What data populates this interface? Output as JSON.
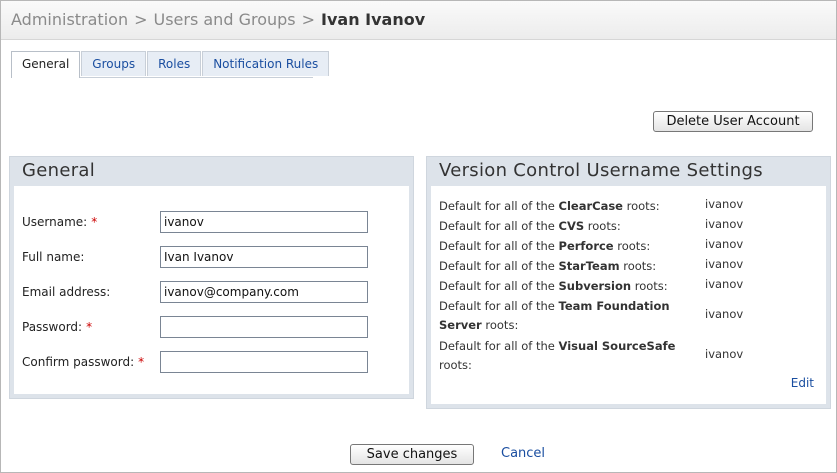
{
  "breadcrumb": {
    "items": [
      "Administration",
      "Users and Groups"
    ],
    "separator": ">",
    "current": "Ivan Ivanov"
  },
  "tabs": [
    {
      "label": "General",
      "active": true
    },
    {
      "label": "Groups",
      "active": false
    },
    {
      "label": "Roles",
      "active": false
    },
    {
      "label": "Notification Rules",
      "active": false
    }
  ],
  "actions": {
    "delete_label": "Delete User Account",
    "save_label": "Save changes",
    "cancel_label": "Cancel"
  },
  "general_panel": {
    "title": "General",
    "fields": [
      {
        "label": "Username:",
        "required": "*",
        "value": "ivanov"
      },
      {
        "label": "Full name:",
        "required": "",
        "value": "Ivan Ivanov"
      },
      {
        "label": "Email address:",
        "required": "",
        "value": "ivanov@company.com"
      },
      {
        "label": "Password:",
        "required": "*",
        "value": ""
      },
      {
        "label": "Confirm password:",
        "required": "*",
        "value": ""
      }
    ]
  },
  "vcs_panel": {
    "title": "Version Control Username Settings",
    "rows": [
      {
        "prefix": "Default for all of the ",
        "system": "ClearCase",
        "suffix": " roots:",
        "value": "ivanov"
      },
      {
        "prefix": "Default for all of the ",
        "system": "CVS",
        "suffix": " roots:",
        "value": "ivanov"
      },
      {
        "prefix": "Default for all of the ",
        "system": "Perforce",
        "suffix": " roots:",
        "value": "ivanov"
      },
      {
        "prefix": "Default for all of the ",
        "system": "StarTeam",
        "suffix": " roots:",
        "value": "ivanov"
      },
      {
        "prefix": "Default for all of the ",
        "system": "Subversion",
        "suffix": " roots:",
        "value": "ivanov"
      },
      {
        "prefix": "Default for all of the ",
        "system": "Team Foundation Server",
        "suffix": " roots:",
        "value": "ivanov"
      },
      {
        "prefix": "Default for all of the ",
        "system": "Visual SourceSafe",
        "suffix": " roots:",
        "value": "ivanov"
      }
    ],
    "edit_label": "Edit"
  }
}
